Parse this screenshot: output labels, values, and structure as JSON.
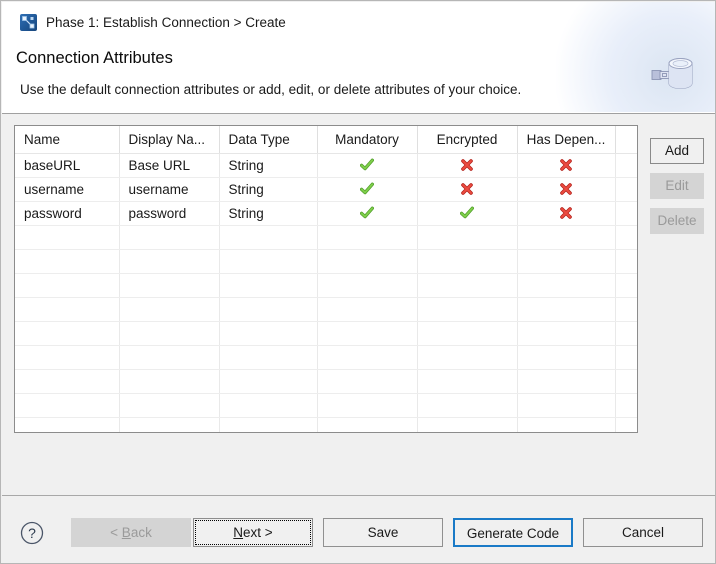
{
  "header": {
    "breadcrumb_icon": "connection-diagram-icon",
    "breadcrumb": "Phase 1: Establish Connection > Create",
    "title": "Connection Attributes",
    "subtitle": "Use the default connection attributes or add, edit, or delete attributes of your choice.",
    "decoration_icon": "database-connection-icon"
  },
  "table": {
    "columns": [
      {
        "label": "Name",
        "align": "left"
      },
      {
        "label": "Display Na...",
        "align": "left"
      },
      {
        "label": "Data Type",
        "align": "left"
      },
      {
        "label": "Mandatory",
        "align": "center"
      },
      {
        "label": "Encrypted",
        "align": "center"
      },
      {
        "label": "Has Depen...",
        "align": "center"
      }
    ],
    "rows": [
      {
        "name": "baseURL",
        "display_name": "Base URL",
        "data_type": "String",
        "mandatory": true,
        "encrypted": false,
        "has_dependency": false
      },
      {
        "name": "username",
        "display_name": "username",
        "data_type": "String",
        "mandatory": true,
        "encrypted": false,
        "has_dependency": false
      },
      {
        "name": "password",
        "display_name": "password",
        "data_type": "String",
        "mandatory": true,
        "encrypted": true,
        "has_dependency": false
      }
    ],
    "empty_row_count": 9,
    "check_icon": "green-check-icon",
    "cross_icon": "red-cross-icon"
  },
  "side_buttons": [
    {
      "label": "Add",
      "enabled": true
    },
    {
      "label": "Edit",
      "enabled": false
    },
    {
      "label": "Delete",
      "enabled": false
    }
  ],
  "footer": {
    "help_icon": "help-question-icon",
    "back_label": "< Back",
    "back_mnemonic": "B",
    "back_prefix": "< ",
    "back_suffix": "ack",
    "next_prefix": "",
    "next_mnemonic": "N",
    "next_suffix": "ext >",
    "save_label": "Save",
    "generate_label": "Generate Code",
    "cancel_label": "Cancel"
  },
  "colors": {
    "accent_blue": "#1a7ac7",
    "check_green": "#5aae2f",
    "cross_red": "#d9342b",
    "panel_grey": "#f0f0f0",
    "disabled_grey": "#d4d4d4"
  }
}
